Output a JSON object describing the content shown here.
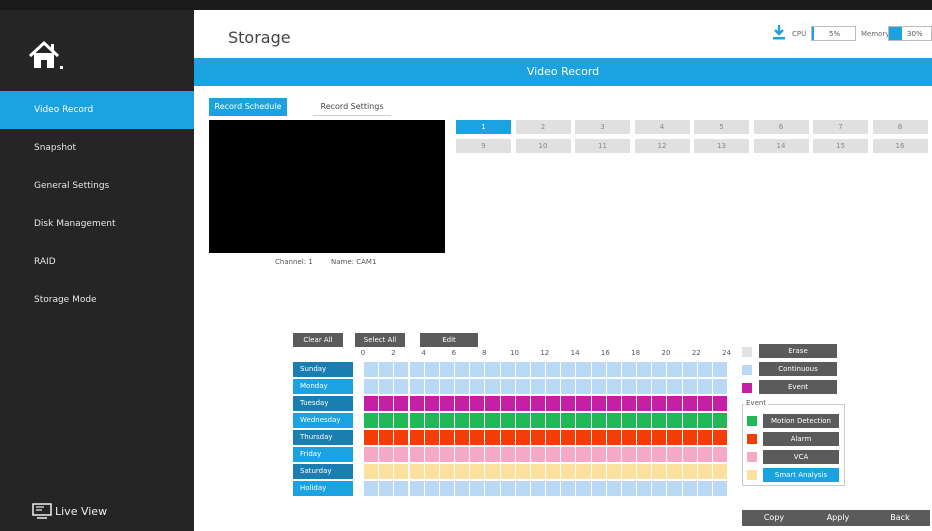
{
  "app": {
    "page_title": "Storage"
  },
  "sidebar": {
    "items": [
      {
        "label": "Video Record",
        "active": true
      },
      {
        "label": "Snapshot"
      },
      {
        "label": "General Settings"
      },
      {
        "label": "Disk Management"
      },
      {
        "label": "RAID"
      },
      {
        "label": "Storage Mode"
      }
    ],
    "live_view_label": "Live View"
  },
  "header": {
    "cpu_label": "CPU",
    "cpu_value": "5%",
    "cpu_level": 0.05,
    "memory_label": "Memory",
    "memory_value": "30%",
    "memory_level": 0.3
  },
  "banner": {
    "title": "Video Record"
  },
  "tabs": [
    {
      "label": "Record Schedule",
      "active": true
    },
    {
      "label": "Record Settings"
    }
  ],
  "preview": {
    "channel_text": "Channel: 1",
    "name_text": "Name: CAM1"
  },
  "channels": [
    "1",
    "2",
    "3",
    "4",
    "5",
    "6",
    "7",
    "8",
    "9",
    "10",
    "11",
    "12",
    "13",
    "14",
    "15",
    "16"
  ],
  "selected_channel": "1",
  "schedule": {
    "buttons": {
      "clear_all": "Clear All",
      "select_all": "Select All",
      "edit": "Edit"
    },
    "hour_labels": [
      "0",
      "2",
      "4",
      "6",
      "8",
      "10",
      "12",
      "14",
      "16",
      "18",
      "20",
      "22",
      "24"
    ],
    "days": [
      {
        "label": "Sunday",
        "mode": "continuous"
      },
      {
        "label": "Monday",
        "mode": "continuous"
      },
      {
        "label": "Tuesday",
        "mode": "event"
      },
      {
        "label": "Wednesday",
        "mode": "motion"
      },
      {
        "label": "Thursday",
        "mode": "alarm"
      },
      {
        "label": "Friday",
        "mode": "vca"
      },
      {
        "label": "Saturday",
        "mode": "smart"
      },
      {
        "label": "Holiday",
        "mode": "continuous"
      }
    ]
  },
  "legend": {
    "erase": "Erase",
    "continuous": "Continuous",
    "event": "Event",
    "event_group_label": "Event",
    "motion": "Motion Detection",
    "alarm": "Alarm",
    "vca": "VCA",
    "smart": "Smart Analysis"
  },
  "colors": {
    "accent": "#1aa3e0",
    "continuous": "#b9d9f4",
    "event": "#c51fa6",
    "motion": "#21b955",
    "alarm": "#f23d07",
    "vca": "#f5a9c6",
    "smart": "#fbe09e",
    "erase": "#e3e3e3",
    "day_dark": "#1a7fb0",
    "day_light": "#1aa3e0"
  },
  "footer": {
    "copy": "Copy",
    "apply": "Apply",
    "back": "Back"
  }
}
